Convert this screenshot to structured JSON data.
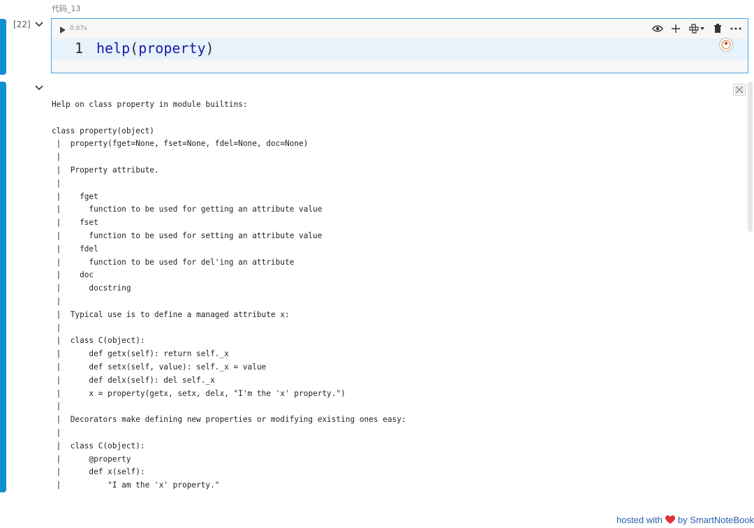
{
  "cell": {
    "title": "代码_13",
    "exec_count": "[22]",
    "exec_time": "0.07s",
    "line_number": "1",
    "code": {
      "fn": "help",
      "open": "(",
      "arg": "property",
      "close": ")"
    }
  },
  "output": {
    "lines": [
      "Help on class property in module builtins:",
      "",
      "class property(object)",
      " |  property(fget=None, fset=None, fdel=None, doc=None)",
      " |",
      " |  Property attribute.",
      " |",
      " |    fget",
      " |      function to be used for getting an attribute value",
      " |    fset",
      " |      function to be used for setting an attribute value",
      " |    fdel",
      " |      function to be used for del'ing an attribute",
      " |    doc",
      " |      docstring",
      " |",
      " |  Typical use is to define a managed attribute x:",
      " |",
      " |  class C(object):",
      " |      def getx(self): return self._x",
      " |      def setx(self, value): self._x = value",
      " |      def delx(self): del self._x",
      " |      x = property(getx, setx, delx, \"I'm the 'x' property.\")",
      " |",
      " |  Decorators make defining new properties or modifying existing ones easy:",
      " |",
      " |  class C(object):",
      " |      @property",
      " |      def x(self):",
      " |          \"I am the 'x' property.\""
    ]
  },
  "footer": {
    "hosted": "hosted with",
    "by": "by SmartNoteBook"
  },
  "colors": {
    "accent": "#0e8fd1",
    "border": "#4aa3df",
    "heart": "#e03131",
    "link": "#2a5db0"
  },
  "icons": [
    "chevron-down-icon",
    "play-icon",
    "eye-icon",
    "plus-icon",
    "python-icon",
    "delete-icon",
    "more-icon",
    "ai-assist-icon",
    "output-toggle-icon",
    "heart-icon"
  ]
}
